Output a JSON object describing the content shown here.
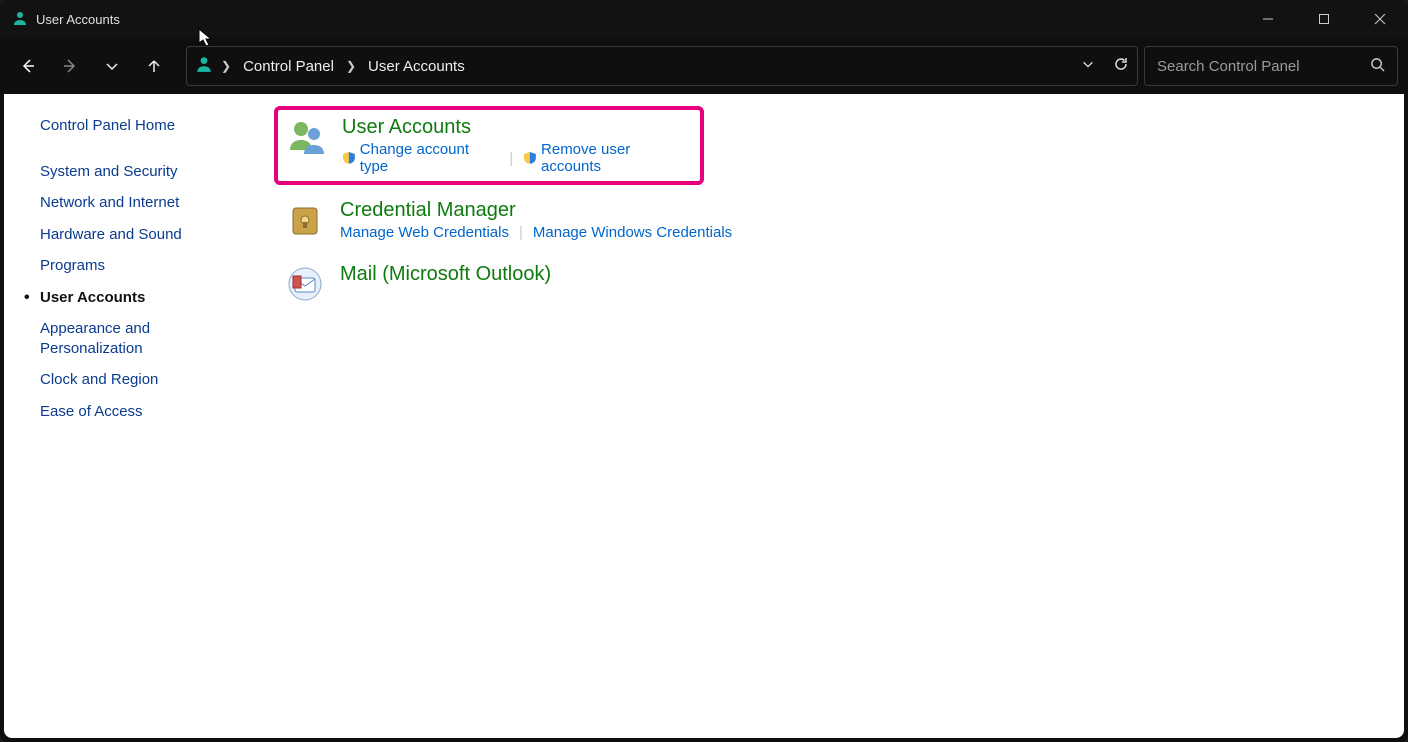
{
  "titlebar": {
    "title": "User Accounts"
  },
  "breadcrumb": {
    "item1": "Control Panel",
    "item2": "User Accounts"
  },
  "search": {
    "placeholder": "Search Control Panel"
  },
  "sidebar": {
    "items": [
      "Control Panel Home",
      "System and Security",
      "Network and Internet",
      "Hardware and Sound",
      "Programs",
      "User Accounts",
      "Appearance and Personalization",
      "Clock and Region",
      "Ease of Access"
    ]
  },
  "categories": {
    "userAccounts": {
      "title": "User Accounts",
      "link1": "Change account type",
      "link2": "Remove user accounts"
    },
    "credentialManager": {
      "title": "Credential Manager",
      "link1": "Manage Web Credentials",
      "link2": "Manage Windows Credentials"
    },
    "mail": {
      "title": "Mail (Microsoft Outlook)"
    }
  }
}
